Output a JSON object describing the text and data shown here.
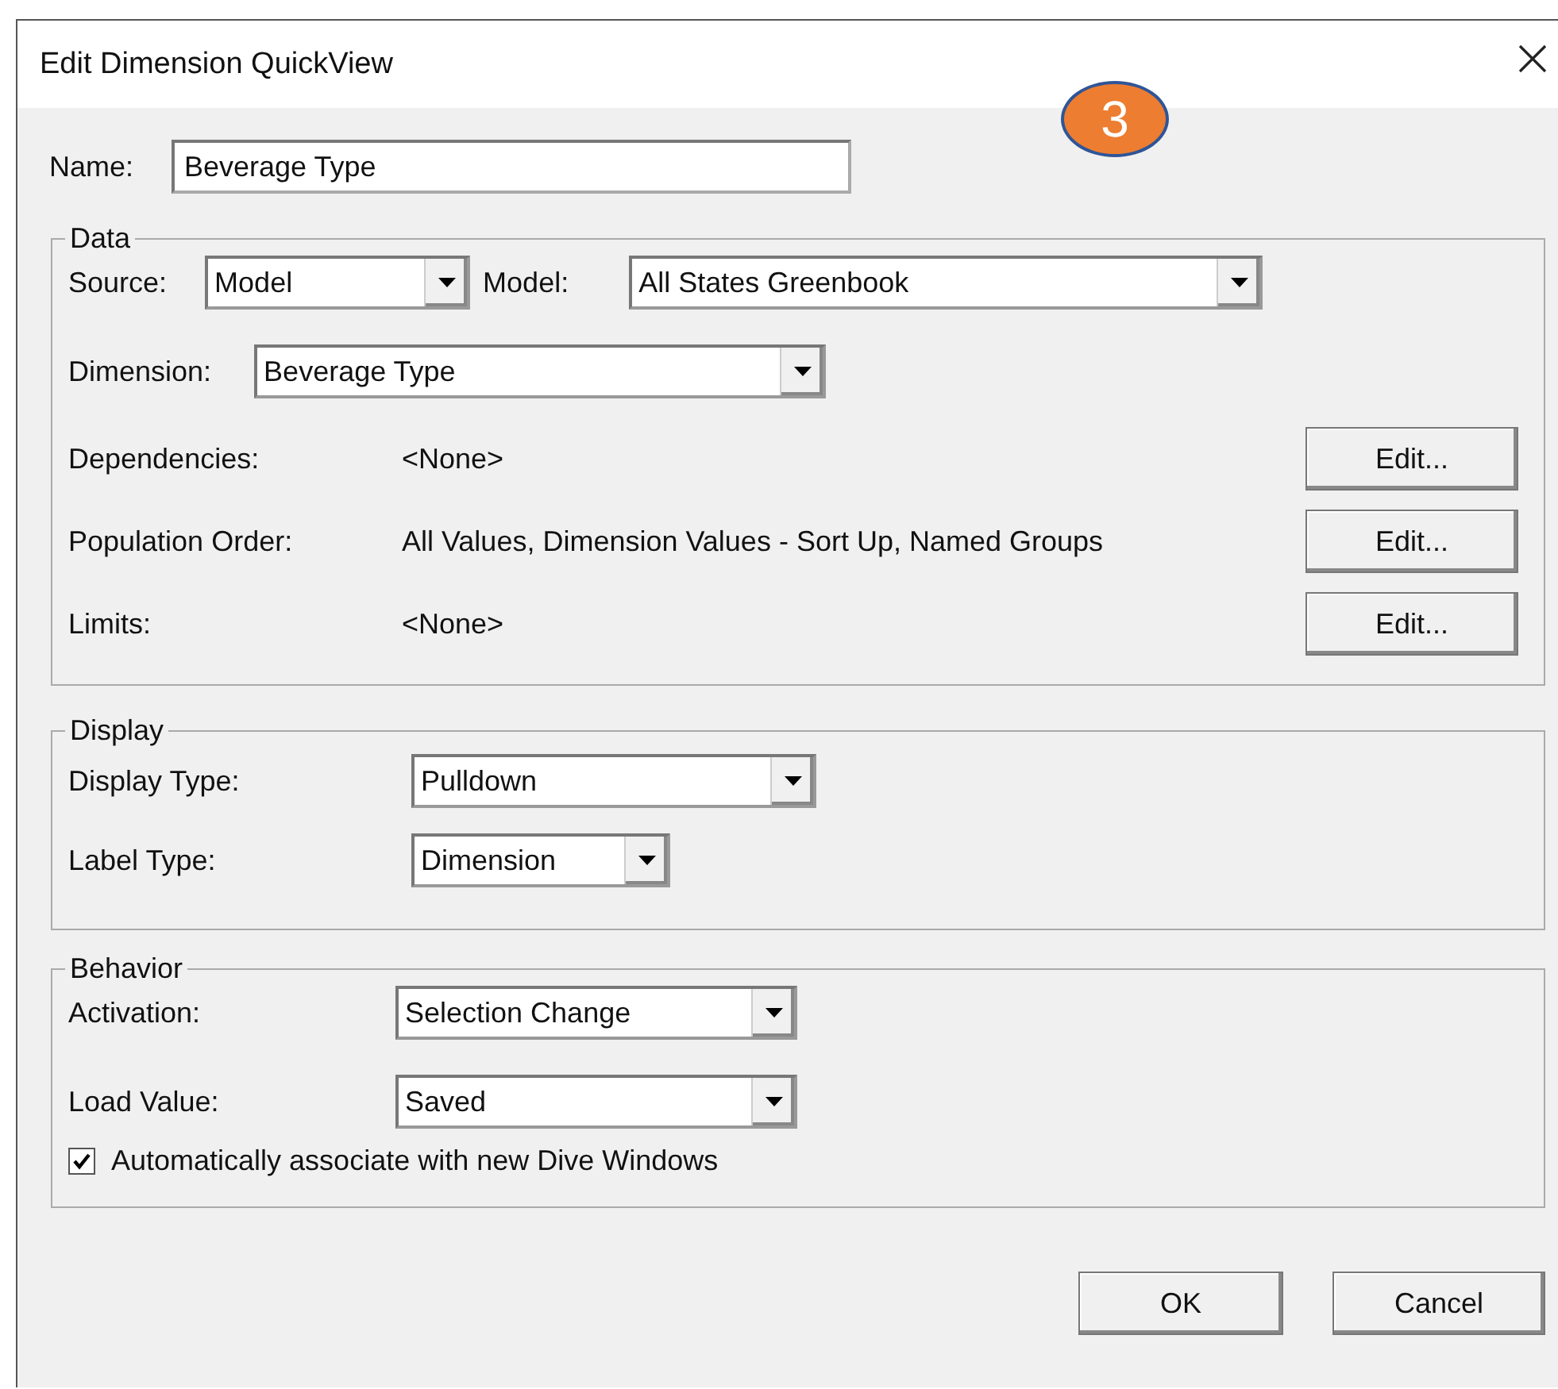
{
  "window": {
    "title": "Edit Dimension QuickView"
  },
  "badge": {
    "text": "3"
  },
  "name": {
    "label": "Name:",
    "value": "Beverage Type"
  },
  "data": {
    "title": "Data",
    "source": {
      "label": "Source:",
      "value": "Model"
    },
    "model": {
      "label": "Model:",
      "value": "All States Greenbook"
    },
    "dimension": {
      "label": "Dimension:",
      "value": "Beverage Type"
    },
    "rows": [
      {
        "label": "Dependencies:",
        "value": "<None>",
        "button": "Edit..."
      },
      {
        "label": "Population Order:",
        "value": "All Values, Dimension Values - Sort Up, Named Groups",
        "button": "Edit..."
      },
      {
        "label": "Limits:",
        "value": "<None>",
        "button": "Edit..."
      }
    ]
  },
  "display": {
    "title": "Display",
    "fields": [
      {
        "label": "Display Type:",
        "value": "Pulldown"
      },
      {
        "label": "Label Type:",
        "value": "Dimension"
      }
    ]
  },
  "behavior": {
    "title": "Behavior",
    "fields": [
      {
        "label": "Activation:",
        "value": "Selection Change"
      },
      {
        "label": "Load Value:",
        "value": "Saved"
      }
    ],
    "checkbox": {
      "label": "Automatically associate with new Dive Windows",
      "checked": true
    }
  },
  "buttons": [
    {
      "label": "OK"
    },
    {
      "label": "Cancel"
    }
  ]
}
